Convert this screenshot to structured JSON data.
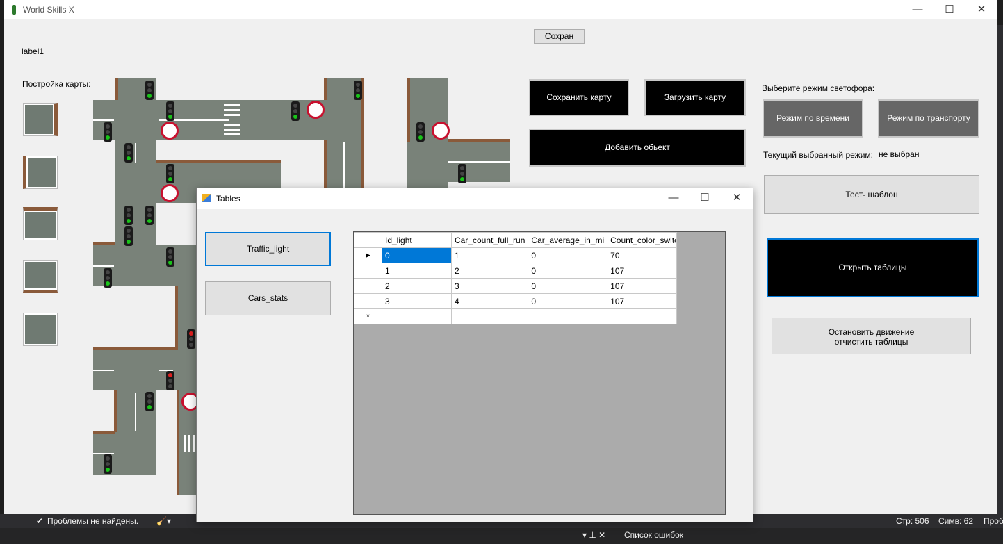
{
  "window": {
    "title": "World Skills X",
    "controls": [
      "—",
      "☐",
      "✕"
    ]
  },
  "main": {
    "save_button": "Сохран",
    "label1": "label1",
    "palette_label": "Постройка карты:",
    "save_map": "Сохранить карту",
    "load_map": "Загрузить карту",
    "add_object": "Добавить обьект",
    "mode_prompt": "Выберите режим светофора:",
    "mode_time": "Режим по времени",
    "mode_transport": "Режим по транспорту",
    "current_mode_label": "Текущий выбранный режим:",
    "current_mode_value": "не выбран",
    "test_template": "Тест- шаблон",
    "open_tables": "Открыть таблицы",
    "stop_line1": "Остановить движение",
    "stop_line2": "отчистить таблицы"
  },
  "dialog": {
    "title": "Tables",
    "controls": [
      "—",
      "☐",
      "✕"
    ],
    "buttons": [
      "Traffic_light",
      "Cars_stats"
    ],
    "columns": [
      "Id_light",
      "Car_count_full_run",
      "Car_average_in_mi",
      "Count_color_switch"
    ],
    "rows": [
      [
        "0",
        "1",
        "0",
        "70"
      ],
      [
        "1",
        "2",
        "0",
        "107"
      ],
      [
        "2",
        "3",
        "0",
        "107"
      ],
      [
        "3",
        "4",
        "0",
        "107"
      ]
    ],
    "current_row_marker": "▶",
    "new_row_marker": "*"
  },
  "ide": {
    "status_problems": "Проблемы не найдены.",
    "line": "Стр: 506",
    "col": "Симв: 62",
    "right_cut": "Проб",
    "bottom_panel": "Список ошибок"
  },
  "colors": {
    "accent": "#0078d7",
    "road": "#798279",
    "curb": "#8a5a3a",
    "sign_red": "#c8102e"
  }
}
